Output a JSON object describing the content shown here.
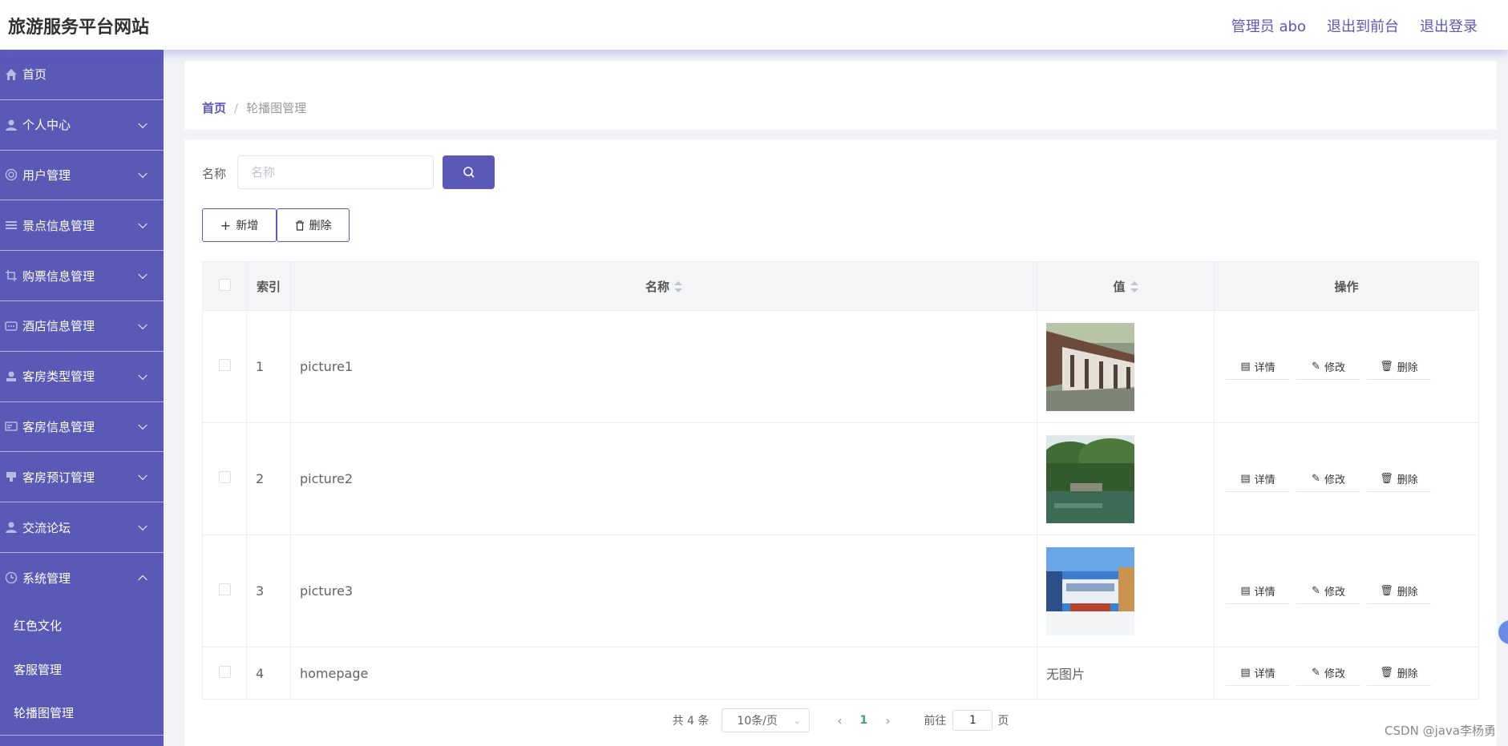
{
  "header": {
    "title": "旅游服务平台网站",
    "admin": "管理员 abo",
    "to_front": "退出到前台",
    "logout": "退出登录"
  },
  "sidebar": {
    "items": [
      {
        "label": "首页",
        "icon": "home-icon",
        "expandable": false
      },
      {
        "label": "个人中心",
        "icon": "user-icon",
        "expandable": true
      },
      {
        "label": "用户管理",
        "icon": "users-icon",
        "expandable": true
      },
      {
        "label": "景点信息管理",
        "icon": "list-icon",
        "expandable": true
      },
      {
        "label": "购票信息管理",
        "icon": "crop-icon",
        "expandable": true
      },
      {
        "label": "酒店信息管理",
        "icon": "chat-icon",
        "expandable": true
      },
      {
        "label": "客房类型管理",
        "icon": "person-icon",
        "expandable": true
      },
      {
        "label": "客房信息管理",
        "icon": "card-icon",
        "expandable": true
      },
      {
        "label": "客房预订管理",
        "icon": "stamp-icon",
        "expandable": true
      },
      {
        "label": "交流论坛",
        "icon": "person-icon",
        "expandable": true
      },
      {
        "label": "系统管理",
        "icon": "clock-icon",
        "expandable": true,
        "expanded": true
      }
    ],
    "sub_items": [
      "红色文化",
      "客服管理",
      "轮播图管理"
    ]
  },
  "breadcrumb": {
    "home": "首页",
    "separator": "/",
    "current": "轮播图管理"
  },
  "search": {
    "label": "名称",
    "placeholder": "名称"
  },
  "actions": {
    "add": "新增",
    "delete": "删除"
  },
  "table": {
    "headers": {
      "index": "索引",
      "name": "名称",
      "value": "值",
      "ops": "操作"
    },
    "rows": [
      {
        "index": "1",
        "name": "picture1",
        "image": "corridor"
      },
      {
        "index": "2",
        "name": "picture2",
        "image": "garden"
      },
      {
        "index": "3",
        "name": "picture3",
        "image": "street"
      },
      {
        "index": "4",
        "name": "homepage",
        "value_text": "无图片"
      }
    ],
    "op_labels": {
      "detail": "详情",
      "edit": "修改",
      "delete": "删除"
    }
  },
  "pagination": {
    "total": "共 4 条",
    "page_size": "10条/页",
    "current_page": "1",
    "goto": "前往",
    "goto_value": "1",
    "page_unit": "页"
  },
  "watermark": "CSDN @java李杨勇",
  "colors": {
    "primary": "#5a59b6",
    "current_page": "#3aa87a"
  }
}
